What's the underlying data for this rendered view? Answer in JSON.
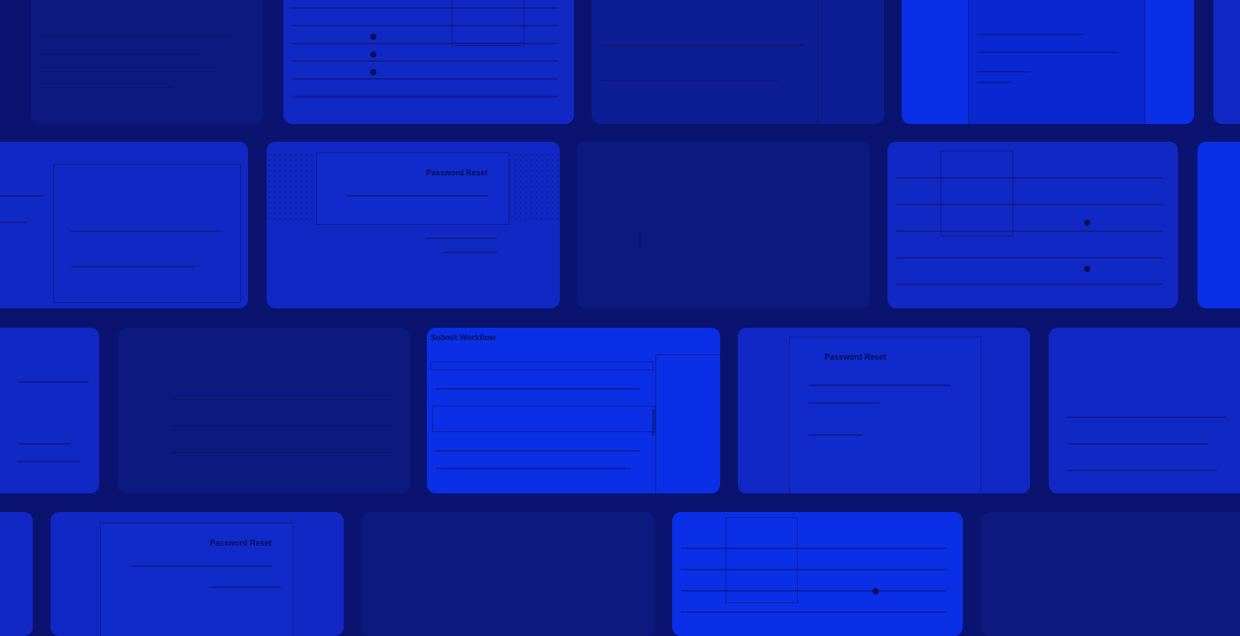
{
  "tiles": {
    "row3_center": {
      "title": "Submit Workflow"
    },
    "row2_left": {
      "title": "Password Reset"
    },
    "row3_right": {
      "title": "Password Reset"
    },
    "row4_left": {
      "title": "Password Reset"
    }
  },
  "colors": {
    "background": "#0a1470",
    "tile_dim": "#0d1e94",
    "tile_mid": "#1128c4",
    "tile_highlight": "#0a2fe6"
  }
}
